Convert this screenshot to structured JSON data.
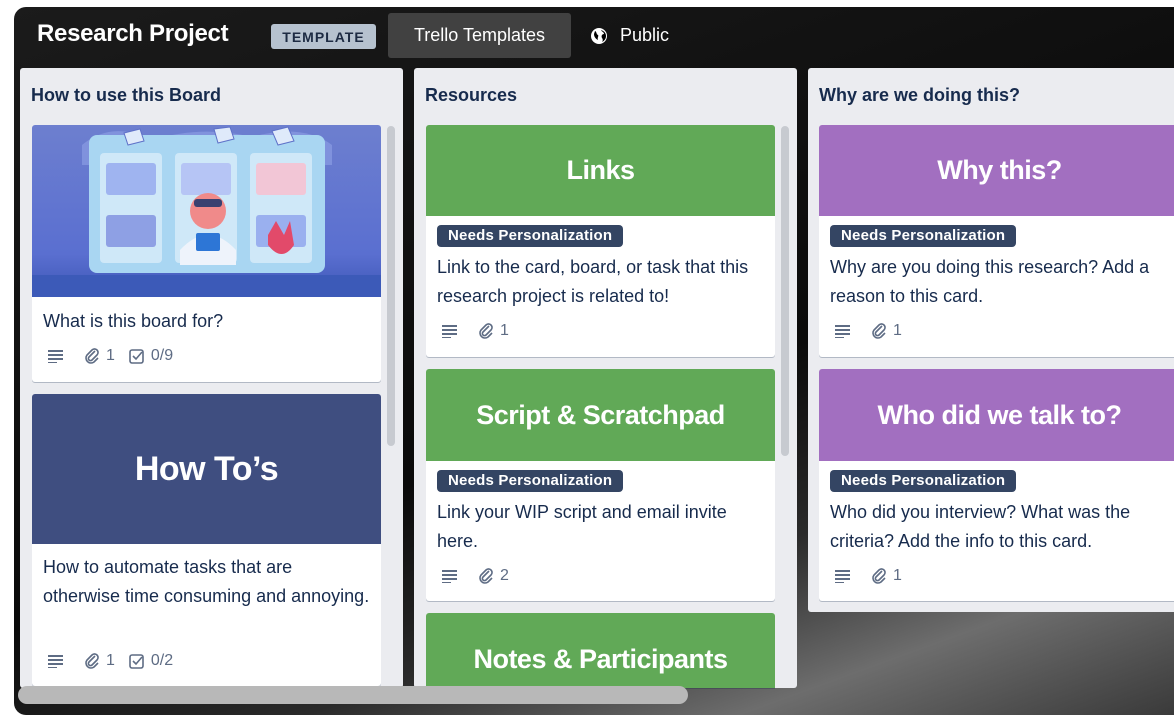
{
  "header": {
    "board_title": "Research Project",
    "template_badge": "TEMPLATE",
    "templates_button": "Trello Templates",
    "visibility": "Public"
  },
  "lists": [
    {
      "title": "How to use this Board",
      "cards": [
        {
          "cover": "illustration",
          "text": "What is this board for?",
          "badges": {
            "attachments": "1",
            "checklist": "0/9"
          }
        },
        {
          "cover_title": "How To’s",
          "cover_color": "#3f4e80",
          "text": "How to automate tasks that are otherwise time consuming and annoying.",
          "badges": {
            "attachments": "1",
            "checklist": "0/2"
          }
        }
      ]
    },
    {
      "title": "Resources",
      "cards": [
        {
          "cover_title": "Links",
          "cover_color": "#61a957",
          "label": "Needs Personalization",
          "text": "Link to the card, board, or task that this research project is related to!",
          "badges": {
            "attachments": "1"
          }
        },
        {
          "cover_title": "Script & Scratchpad",
          "cover_color": "#61a957",
          "label": "Needs Personalization",
          "text": "Link your WIP script and email invite here.",
          "badges": {
            "attachments": "2"
          }
        },
        {
          "cover_title": "Notes & Participants",
          "cover_color": "#61a957"
        }
      ]
    },
    {
      "title": "Why are we doing this?",
      "cards": [
        {
          "cover_title": "Why this?",
          "cover_color": "#a26fc0",
          "label": "Needs Personalization",
          "text": "Why are you doing this research? Add a reason to this card.",
          "badges": {
            "attachments": "1"
          }
        },
        {
          "cover_title": "Who did we talk to?",
          "cover_color": "#a26fc0",
          "label": "Needs Personalization",
          "text": "Who did you interview? What was the criteria? Add the info to this card.",
          "badges": {
            "attachments": "1"
          }
        }
      ]
    }
  ],
  "icons": {
    "description": "description-lines-icon",
    "attachment": "paperclip-icon",
    "checklist": "checkbox-icon",
    "public": "globe-icon"
  }
}
